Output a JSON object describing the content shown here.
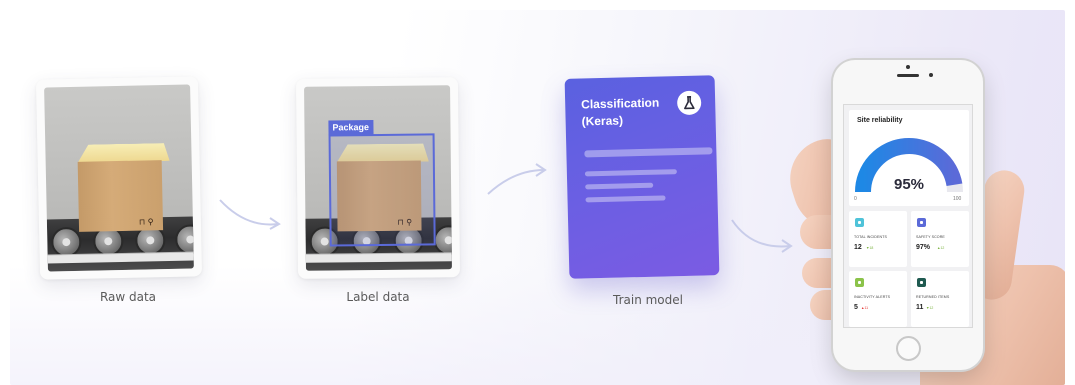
{
  "steps": {
    "raw": {
      "caption": "Raw data",
      "box_mark": "⊓ ⚲"
    },
    "label": {
      "caption": "Label data",
      "bbox_label": "Package",
      "box_mark": "⊓ ⚲"
    },
    "train": {
      "caption": "Train model",
      "title": "Classification (Keras)",
      "icon": "flask-icon"
    },
    "deploy": {
      "panel_title": "Site reliability",
      "gauge_value": "95%",
      "gauge_fraction": 0.95,
      "gauge_min": "0",
      "gauge_max": "100",
      "tiles": [
        {
          "label": "TOTAL INCIDENTS",
          "value": "12",
          "delta": "▼18",
          "delta_color": "#7cb342",
          "icon_color": "#4fc3d9"
        },
        {
          "label": "SAFETY SCORE",
          "value": "97%",
          "delta": "▲12",
          "delta_color": "#7cb342",
          "icon_color": "#5b6ad8"
        },
        {
          "label": "INACTIVITY ALERTS",
          "value": "5",
          "delta": "▲11",
          "delta_color": "#e53935",
          "icon_color": "#8bc34a"
        },
        {
          "label": "RETURNED ITEMS",
          "value": "11",
          "delta": "▼12",
          "delta_color": "#7cb342",
          "icon_color": "#1f5a50"
        }
      ]
    }
  },
  "colors": {
    "accent": "#5b6ad8",
    "card_gradient_start": "#5a61e0",
    "card_gradient_end": "#7b5be3",
    "gauge_start": "#1e88e5",
    "gauge_end": "#5b6ad8"
  }
}
